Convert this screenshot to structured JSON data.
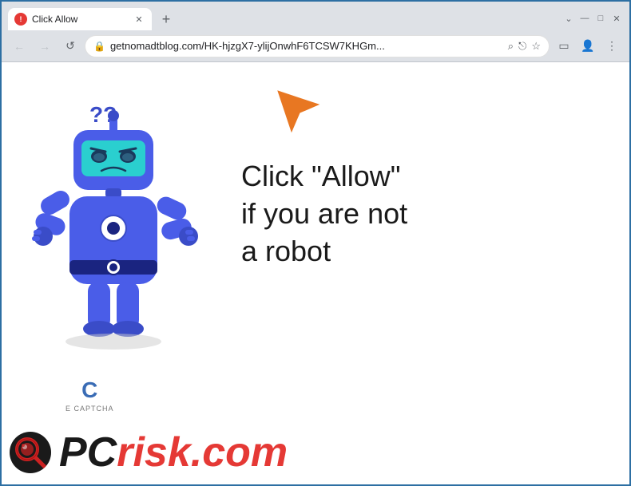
{
  "window": {
    "title": "Click Allow",
    "favicon_color": "#e53935"
  },
  "browser": {
    "back_label": "←",
    "forward_label": "→",
    "reload_label": "↺",
    "url": "getnomadtblog.com/HK-hjzgX7-ylijOnwhF6TCSW7KHGm...",
    "lock_icon": "🔒",
    "new_tab_label": "+",
    "minimize_label": "—",
    "maximize_label": "□",
    "close_label": "✕",
    "tab_close_label": "✕",
    "search_icon": "⌕",
    "share_icon": "⎋",
    "bookmark_icon": "☆",
    "sidebar_icon": "▭",
    "profile_icon": "👤",
    "menu_icon": "⋮"
  },
  "page": {
    "main_text_line1": "Click \"Allow\"",
    "main_text_line2": "if you are not",
    "main_text_line3": "a robot",
    "ecaptcha_label": "E CAPTCHA",
    "pcrisk_text": "PC",
    "pcrisk_suffix": "risk.com"
  },
  "colors": {
    "robot_body": "#4a5de8",
    "robot_visor": "#2acfcf",
    "arrow_color": "#e87722",
    "window_border": "#2d6fa3"
  }
}
